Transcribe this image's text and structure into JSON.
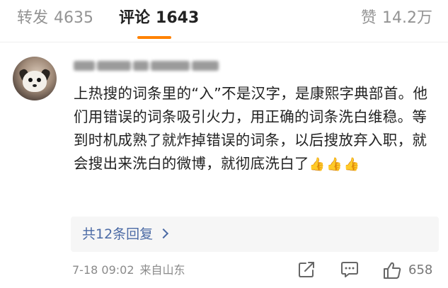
{
  "tabs": {
    "repost": {
      "label": "转发",
      "count": "4635"
    },
    "comment": {
      "label": "评论",
      "count": "1643"
    },
    "like": {
      "label": "赞",
      "count": "14.2万"
    }
  },
  "comment": {
    "text": "上热搜的词条里的“入”不是汉字，是康熙字典部首。他们用错误的词条吸引火力，用正确的词条洗白维稳。等到时机成熟了就炸掉错误的词条，以后搜放弃入职，就会搜出来洗白的微博，就彻底洗白了",
    "emojis": "👍👍👍",
    "replies_label": "共12条回复",
    "time": "7-18 09:02",
    "source": "来自山东",
    "like_count": "658"
  },
  "colors": {
    "accent": "#ff8200",
    "link": "#4b6aa5",
    "muted": "#8a8a8a"
  },
  "icons": [
    "share-icon",
    "comment-icon",
    "thumbs-up-icon",
    "chevron-right-icon"
  ]
}
